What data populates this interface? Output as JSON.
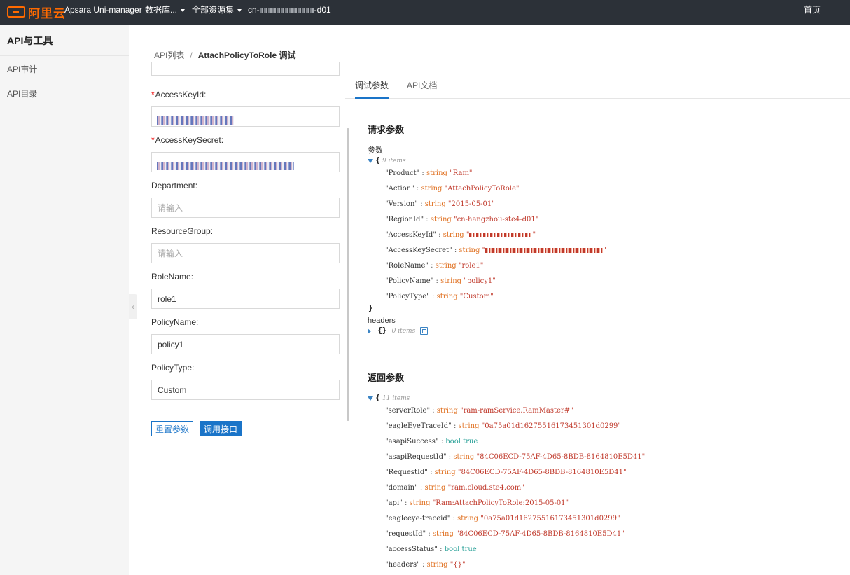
{
  "topbar": {
    "logo_text": "阿里云",
    "product": "Apsara Uni-manager",
    "menu_db": "数据库...",
    "menu_resources": "全部资源集",
    "region_prefix": "cn-",
    "region_suffix": "-d01",
    "home": "首页"
  },
  "sidebar": {
    "title": "API与工具",
    "items": [
      {
        "label": "API审计"
      },
      {
        "label": "API目录"
      }
    ]
  },
  "breadcrumb": {
    "parent": "API列表",
    "separator": "/",
    "current": "AttachPolicyToRole 调试"
  },
  "form": {
    "required_mark": "*",
    "fields": [
      {
        "label": "AccessKeyId:",
        "value": "",
        "placeholder": "",
        "required": true
      },
      {
        "label": "AccessKeySecret:",
        "value": "",
        "placeholder": "",
        "required": true
      },
      {
        "label": "Department:",
        "value": "",
        "placeholder": "请输入",
        "required": false
      },
      {
        "label": "ResourceGroup:",
        "value": "",
        "placeholder": "请输入",
        "required": false
      },
      {
        "label": "RoleName:",
        "value": "role1",
        "placeholder": "",
        "required": false
      },
      {
        "label": "PolicyName:",
        "value": "policy1",
        "placeholder": "",
        "required": false
      },
      {
        "label": "PolicyType:",
        "value": "Custom",
        "placeholder": "",
        "required": false
      }
    ],
    "reset_label": "重置参数",
    "call_label": "调用接口"
  },
  "tabs": [
    {
      "label": "调试参数",
      "active": true
    },
    {
      "label": "API文档",
      "active": false
    }
  ],
  "request": {
    "title": "请求参数",
    "params_label": "参数",
    "params_count": "9 items",
    "params": [
      {
        "key": "\"Product\"",
        "type": "string",
        "value": "\"Ram\""
      },
      {
        "key": "\"Action\"",
        "type": "string",
        "value": "\"AttachPolicyToRole\""
      },
      {
        "key": "\"Version\"",
        "type": "string",
        "value": "\"2015-05-01\""
      },
      {
        "key": "\"RegionId\"",
        "type": "string",
        "value": "\"cn-hangzhou-ste4-d01\""
      },
      {
        "key": "\"AccessKeyId\"",
        "type": "string",
        "value": "\"",
        "value_end": "\"",
        "masked": true
      },
      {
        "key": "\"AccessKeySecret\"",
        "type": "string",
        "value": "\"",
        "value_end": "\"",
        "masked": true
      },
      {
        "key": "\"RoleName\"",
        "type": "string",
        "value": "\"role1\""
      },
      {
        "key": "\"PolicyName\"",
        "type": "string",
        "value": "\"policy1\""
      },
      {
        "key": "\"PolicyType\"",
        "type": "string",
        "value": "\"Custom\""
      }
    ],
    "headers_label": "headers",
    "headers_brace": "{}",
    "headers_count": "0 items"
  },
  "response": {
    "title": "返回参数",
    "count": "11 items",
    "params": [
      {
        "key": "\"serverRole\"",
        "type": "string",
        "value": "\"ram-ramService.RamMaster#\""
      },
      {
        "key": "\"eagleEyeTraceId\"",
        "type": "string",
        "value": "\"0a75a01d16275516173451301d0299\""
      },
      {
        "key": "\"asapiSuccess\"",
        "type": "bool",
        "value": "true"
      },
      {
        "key": "\"asapiRequestId\"",
        "type": "string",
        "value": "\"84C06ECD-75AF-4D65-8BDB-8164810E5D41\""
      },
      {
        "key": "\"RequestId\"",
        "type": "string",
        "value": "\"84C06ECD-75AF-4D65-8BDB-8164810E5D41\""
      },
      {
        "key": "\"domain\"",
        "type": "string",
        "value": "\"ram.cloud.ste4.com\""
      },
      {
        "key": "\"api\"",
        "type": "string",
        "value": "\"Ram:AttachPolicyToRole:2015-05-01\""
      },
      {
        "key": "\"eagleeye-traceid\"",
        "type": "string",
        "value": "\"0a75a01d16275516173451301d0299\""
      },
      {
        "key": "\"requestId\"",
        "type": "string",
        "value": "\"84C06ECD-75AF-4D65-8BDB-8164810E5D41\""
      },
      {
        "key": "\"accessStatus\"",
        "type": "bool",
        "value": "true"
      },
      {
        "key": "\"headers\"",
        "type": "string",
        "value": "\"{}\""
      }
    ]
  },
  "colors": {
    "topbar_bg": "#2c3138",
    "brand": "#ff6a00",
    "primary": "#1a74c8",
    "json_type": "#e07020",
    "json_string": "#c0392b",
    "json_bool": "#2aa198"
  }
}
